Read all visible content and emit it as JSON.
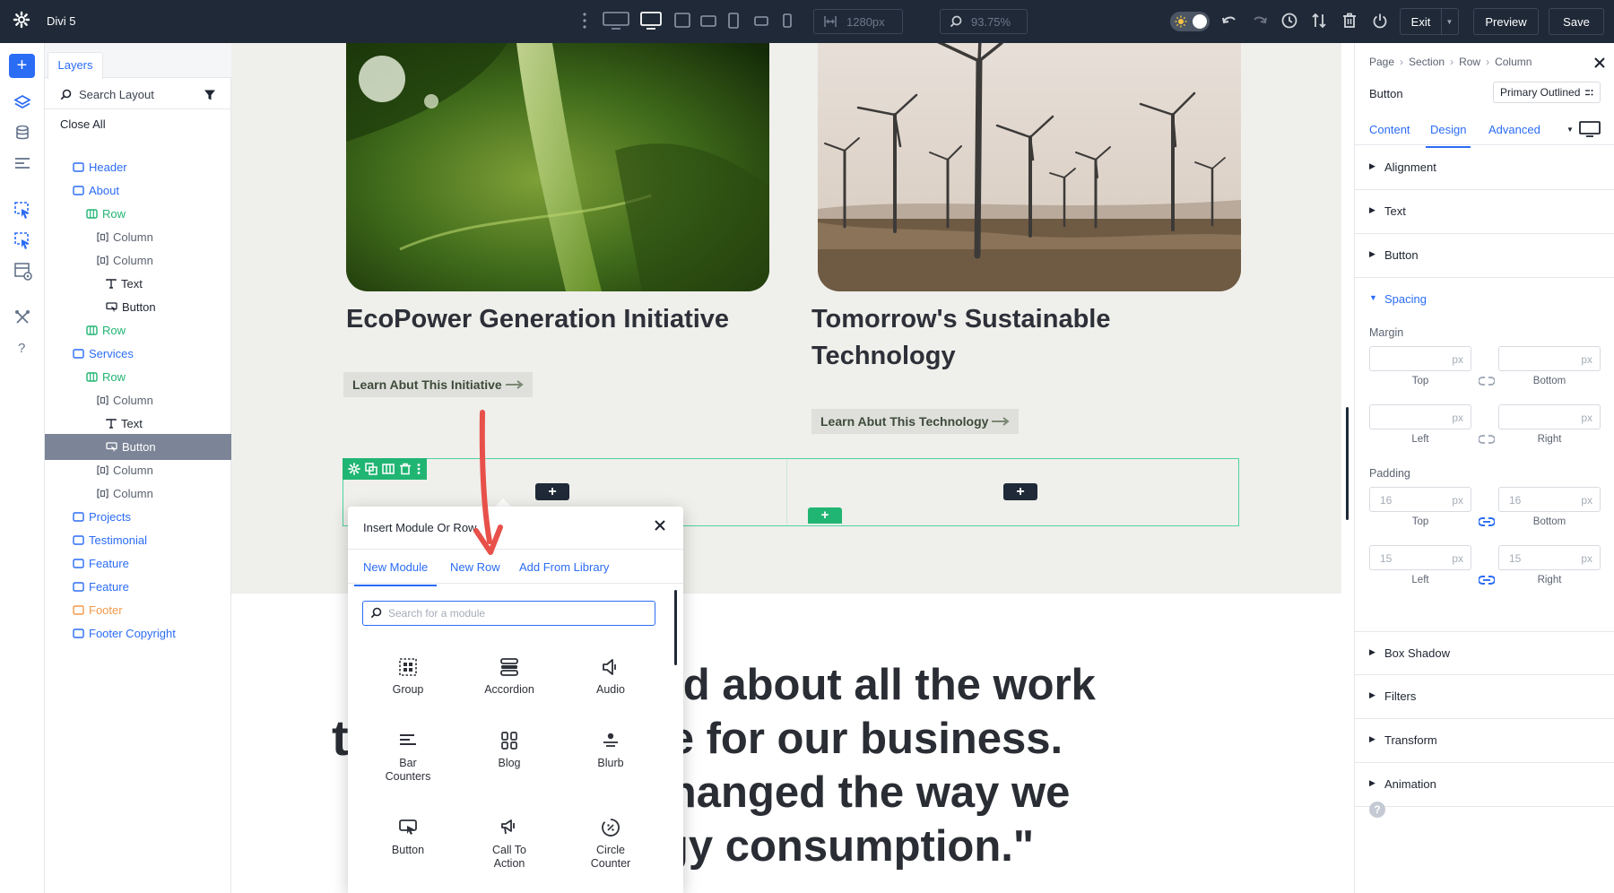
{
  "app": {
    "title": "Divi 5"
  },
  "topbar": {
    "width_value": "1280px",
    "zoom_value": "93.75%",
    "exit_label": "Exit",
    "preview_label": "Preview",
    "save_label": "Save"
  },
  "layers": {
    "tab_label": "Layers",
    "search_placeholder": "Search Layout",
    "close_all": "Close All",
    "items": [
      {
        "label": "Header",
        "type": "section"
      },
      {
        "label": "About",
        "type": "section"
      },
      {
        "label": "Row",
        "type": "row"
      },
      {
        "label": "Column",
        "type": "column"
      },
      {
        "label": "Column",
        "type": "column"
      },
      {
        "label": "Text",
        "type": "text"
      },
      {
        "label": "Button",
        "type": "button"
      },
      {
        "label": "Row",
        "type": "row"
      },
      {
        "label": "Services",
        "type": "section"
      },
      {
        "label": "Row",
        "type": "row"
      },
      {
        "label": "Column",
        "type": "column"
      },
      {
        "label": "Text",
        "type": "text"
      },
      {
        "label": "Button",
        "type": "button",
        "selected": true
      },
      {
        "label": "Column",
        "type": "column"
      },
      {
        "label": "Column",
        "type": "column"
      },
      {
        "label": "Projects",
        "type": "section"
      },
      {
        "label": "Testimonial",
        "type": "section"
      },
      {
        "label": "Feature",
        "type": "section"
      },
      {
        "label": "Feature",
        "type": "section"
      },
      {
        "label": "Footer",
        "type": "footer"
      },
      {
        "label": "Footer Copyright",
        "type": "section"
      }
    ]
  },
  "canvas": {
    "card1": {
      "title": "EcoPower Generation Initiative",
      "button": "Learn Abut This Initiative"
    },
    "card2": {
      "title_line1": "Tomorrow's Sustainable",
      "title_line2": "Technology",
      "button": "Learn Abut This Technology"
    },
    "quote_lines": [
      "xcited about all the work",
      "one for our business.",
      "y changed the way we",
      "rgy consumption.\""
    ],
    "quote_fragments": [
      "t"
    ]
  },
  "modal": {
    "title": "Insert Module Or Row",
    "tabs": [
      "New Module",
      "New Row",
      "Add From Library"
    ],
    "search_placeholder": "Search for a module",
    "modules": [
      {
        "label": "Group",
        "icon": "group-icon"
      },
      {
        "label": "Accordion",
        "icon": "accordion-icon"
      },
      {
        "label": "Audio",
        "icon": "audio-icon"
      },
      {
        "label": "Bar\nCounters",
        "icon": "bar-counters-icon"
      },
      {
        "label": "Blog",
        "icon": "blog-icon"
      },
      {
        "label": "Blurb",
        "icon": "blurb-icon"
      },
      {
        "label": "Button",
        "icon": "button-icon"
      },
      {
        "label": "Call To\nAction",
        "icon": "call-to-action-icon"
      },
      {
        "label": "Circle\nCounter",
        "icon": "circle-counter-icon"
      }
    ]
  },
  "settings": {
    "breadcrumb": [
      "Page",
      "Section",
      "Row",
      "Column"
    ],
    "element_label": "Button",
    "preset": "Primary Outlined",
    "tabs": [
      "Content",
      "Design",
      "Advanced"
    ],
    "sections": {
      "alignment": "Alignment",
      "text": "Text",
      "button": "Button",
      "spacing": "Spacing",
      "box_shadow": "Box Shadow",
      "filters": "Filters",
      "transform": "Transform",
      "animation": "Animation"
    },
    "margin": {
      "label": "Margin",
      "top": "",
      "bottom": "",
      "left": "",
      "right": ""
    },
    "padding": {
      "label": "Padding",
      "top": "16",
      "bottom": "16",
      "left": "15",
      "right": "15"
    },
    "unit": "px",
    "captions": {
      "top": "Top",
      "bottom": "Bottom",
      "left": "Left",
      "right": "Right"
    }
  },
  "colors": {
    "accent": "#2b6cf5",
    "row_green": "#21b573",
    "topbar": "#1f2937",
    "arrow": "#e8504a"
  }
}
